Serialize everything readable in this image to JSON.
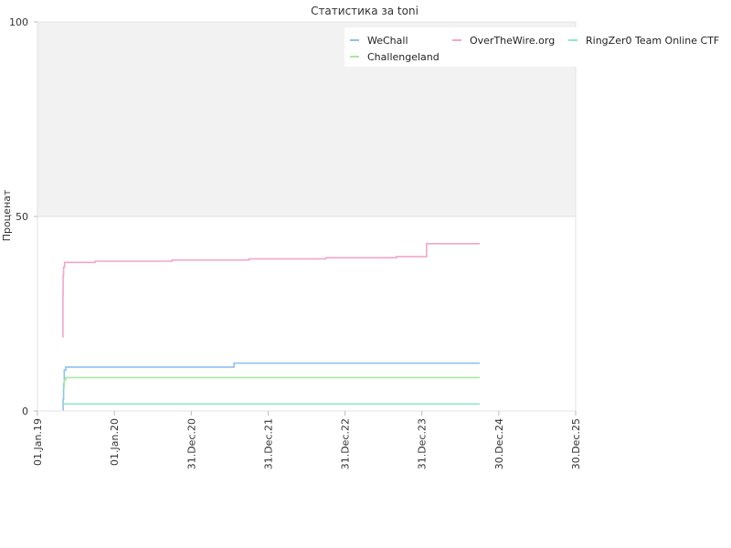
{
  "chart_data": {
    "type": "line",
    "title": "Статистика за toni",
    "ylabel": "Проценат",
    "xlabel": "",
    "ylim": [
      0,
      100
    ],
    "y_ticks": [
      0,
      50,
      100
    ],
    "x_ticks": [
      "01.Jan.19",
      "01.Jan.20",
      "31.Dec.20",
      "31.Dec.21",
      "31.Dec.22",
      "31.Dec.23",
      "30.Dec.24",
      "30.Dec.25"
    ],
    "grid": true,
    "shaded_band": [
      50,
      100
    ],
    "legend_position": "top-right",
    "series": [
      {
        "name": "WeChall",
        "color": "#8ec1ee",
        "points": [
          [
            "2019-05-01",
            0.3
          ],
          [
            "2019-05-03",
            3.0
          ],
          [
            "2019-05-05",
            7.0
          ],
          [
            "2019-05-08",
            10.5
          ],
          [
            "2019-05-15",
            11.3
          ],
          [
            "2021-07-20",
            11.3
          ],
          [
            "2021-07-22",
            12.3
          ],
          [
            "2024-10-01",
            12.3
          ]
        ]
      },
      {
        "name": "OverTheWire.org",
        "color": "#f4a6c8",
        "points": [
          [
            "2019-05-01",
            19.0
          ],
          [
            "2019-05-02",
            30.0
          ],
          [
            "2019-05-03",
            35.0
          ],
          [
            "2019-05-05",
            37.0
          ],
          [
            "2019-05-10",
            38.2
          ],
          [
            "2019-10-01",
            38.5
          ],
          [
            "2020-10-01",
            38.8
          ],
          [
            "2021-10-01",
            39.1
          ],
          [
            "2022-10-01",
            39.4
          ],
          [
            "2023-09-01",
            39.7
          ],
          [
            "2024-01-20",
            39.7
          ],
          [
            "2024-01-22",
            43.0
          ],
          [
            "2024-10-01",
            43.0
          ]
        ]
      },
      {
        "name": "RingZer0 Team Online CTF",
        "color": "#8ee8c8",
        "points": [
          [
            "2019-05-04",
            1.8
          ],
          [
            "2024-10-01",
            1.8
          ]
        ]
      },
      {
        "name": "Challengeland",
        "color": "#a9e8a0",
        "points": [
          [
            "2019-05-03",
            6.0
          ],
          [
            "2019-05-08",
            8.0
          ],
          [
            "2019-05-15",
            8.6
          ],
          [
            "2024-10-01",
            8.6
          ]
        ]
      }
    ]
  }
}
